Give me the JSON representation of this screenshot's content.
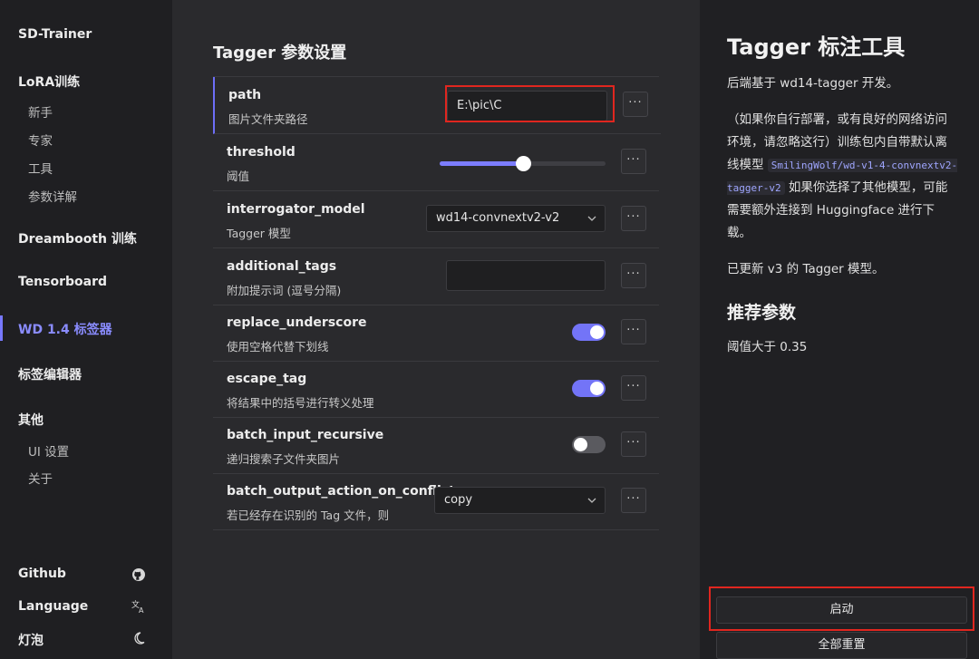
{
  "sidebar": {
    "brand": "SD-Trainer",
    "lora_group": "LoRA训练",
    "lora_items": [
      "新手",
      "专家",
      "工具",
      "参数详解"
    ],
    "dreambooth": "Dreambooth 训练",
    "tensorboard": "Tensorboard",
    "wd_tagger": "WD 1.4 标签器",
    "tag_editor": "标签编辑器",
    "other_group": "其他",
    "other_items": [
      "UI 设置",
      "关于"
    ],
    "footer": {
      "github": "Github",
      "language": "Language",
      "theme": "灯泡"
    }
  },
  "main": {
    "title": "Tagger 参数设置",
    "rows": [
      {
        "name": "path",
        "desc": "图片文件夹路径",
        "value": "E:\\pic\\C"
      },
      {
        "name": "threshold",
        "desc": "阈值",
        "slider_fraction": 0.5
      },
      {
        "name": "interrogator_model",
        "desc": "Tagger 模型",
        "value": "wd14-convnextv2-v2"
      },
      {
        "name": "additional_tags",
        "desc": "附加提示词 (逗号分隔)",
        "value": ""
      },
      {
        "name": "replace_underscore",
        "desc": "使用空格代替下划线",
        "checked": true
      },
      {
        "name": "escape_tag",
        "desc": "将结果中的括号进行转义处理",
        "checked": true
      },
      {
        "name": "batch_input_recursive",
        "desc": "递归搜索子文件夹图片",
        "checked": false
      },
      {
        "name": "batch_output_action_on_conflict",
        "desc": "若已经存在识别的 Tag 文件，则",
        "value": "copy"
      }
    ],
    "more_label": "···"
  },
  "right": {
    "title": "Tagger 标注工具",
    "p1": "后端基于 wd14-tagger 开发。",
    "p2_a": "（如果你自行部署，或有良好的网络访问环境，请忽略这行）训练包内自带默认离线模型",
    "p2_code": "SmilingWolf/wd-v1-4-convnextv2-tagger-v2",
    "p2_b": "如果你选择了其他模型，可能需要额外连接到 Huggingface 进行下载。",
    "p3": "已更新 v3 的 Tagger 模型。",
    "h2": "推荐参数",
    "p4": "阈值大于 0.35",
    "start_button": "启动",
    "reset_button": "全部重置"
  },
  "colors": {
    "accent": "#7374f7",
    "highlight": "#e0261f"
  }
}
